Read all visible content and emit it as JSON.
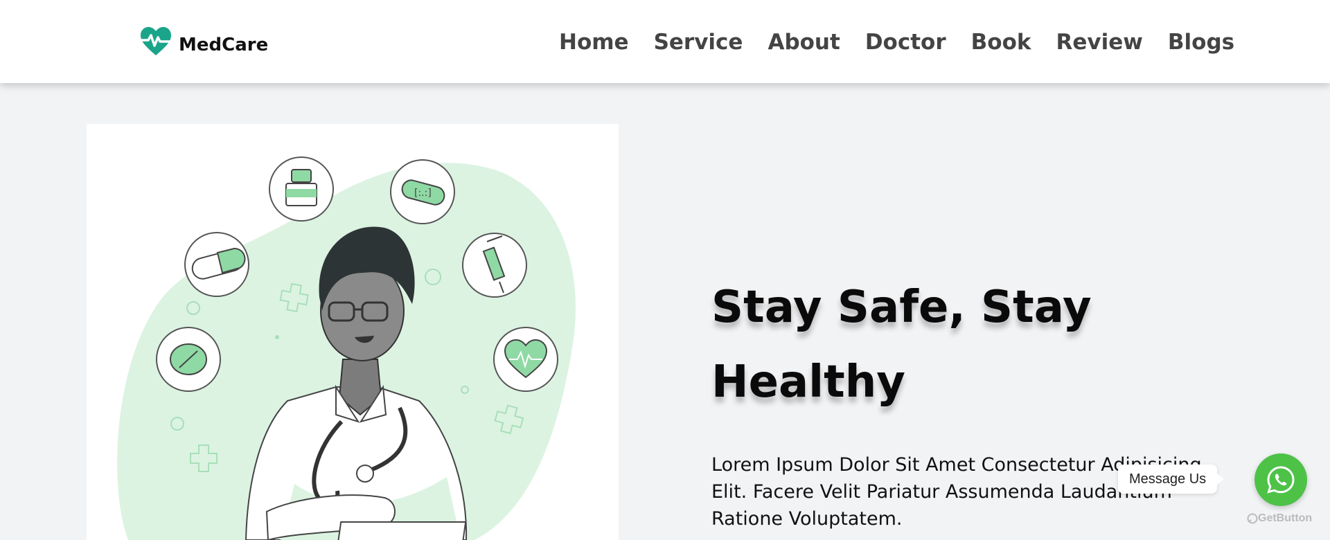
{
  "brand": {
    "name": "MedCare",
    "accent": "#1aa58a"
  },
  "nav": {
    "items": [
      {
        "label": "Home"
      },
      {
        "label": "Service"
      },
      {
        "label": "About"
      },
      {
        "label": "Doctor"
      },
      {
        "label": "Book"
      },
      {
        "label": "Review"
      },
      {
        "label": "Blogs"
      }
    ]
  },
  "hero": {
    "title": "Stay Safe, Stay Healthy",
    "text": "Lorem Ipsum Dolor Sit Amet Consectetur Adipisicing Elit. Facere Velit Pariatur Assumenda Laudantium Ratione Voluptatem.",
    "illustration": "doctor-with-medical-icons"
  },
  "chat_widget": {
    "message_label": "Message Us",
    "button_icon": "whatsapp-icon",
    "button_color": "#4dc247",
    "powered_by": "GetButton"
  }
}
